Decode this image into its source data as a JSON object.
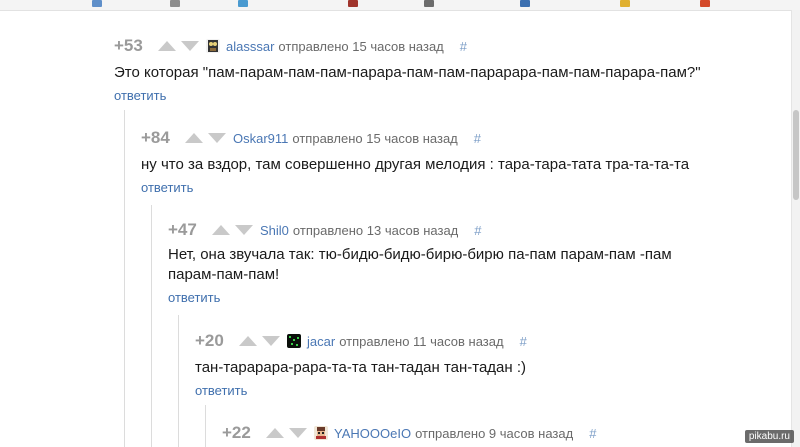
{
  "colors": {
    "rating": "#9a9a9a",
    "author": "#4a77b4",
    "reply": "#3f6fad",
    "vote": "#c9c9c9"
  },
  "comments": [
    {
      "rating": "+53",
      "author": "alasssar",
      "meta": "отправлено 15 часов назад",
      "hash": "#",
      "text": "Это которая \"пам-парам-пам-пам-парара-пам-пам-парарара-пам-пам-парара-пам?\"",
      "reply": "ответить",
      "avatar_icon": "owl-avatar-icon"
    },
    {
      "rating": "+84",
      "author": "Oskar911",
      "meta": "отправлено 15 часов назад",
      "hash": "#",
      "text": "ну что за вздор, там совершенно другая мелодия : тара-тара-тата тра-та-та-та",
      "reply": "ответить"
    },
    {
      "rating": "+47",
      "author": "Shil0",
      "meta": "отправлено 13 часов назад",
      "hash": "#",
      "text_line1": "Нет, она звучала так: тю-бидю-бидю-бирю-бирю па-пам парам-пам -пам",
      "text_line2": "парам-пам-пам!",
      "reply": "ответить"
    },
    {
      "rating": "+20",
      "author": "jacar",
      "meta": "отправлено 11 часов назад",
      "hash": "#",
      "text": "тан-тарарара-рара-та-та тан-тадан тан-тадан :)",
      "reply": "ответить",
      "avatar_icon": "matrix-avatar-icon"
    },
    {
      "rating": "+22",
      "author": "YAHOOOeIO",
      "meta": "отправлено 9 часов назад",
      "hash": "#",
      "avatar_icon": "pixel-avatar-icon"
    }
  ],
  "watermark": "pikabu.ru"
}
